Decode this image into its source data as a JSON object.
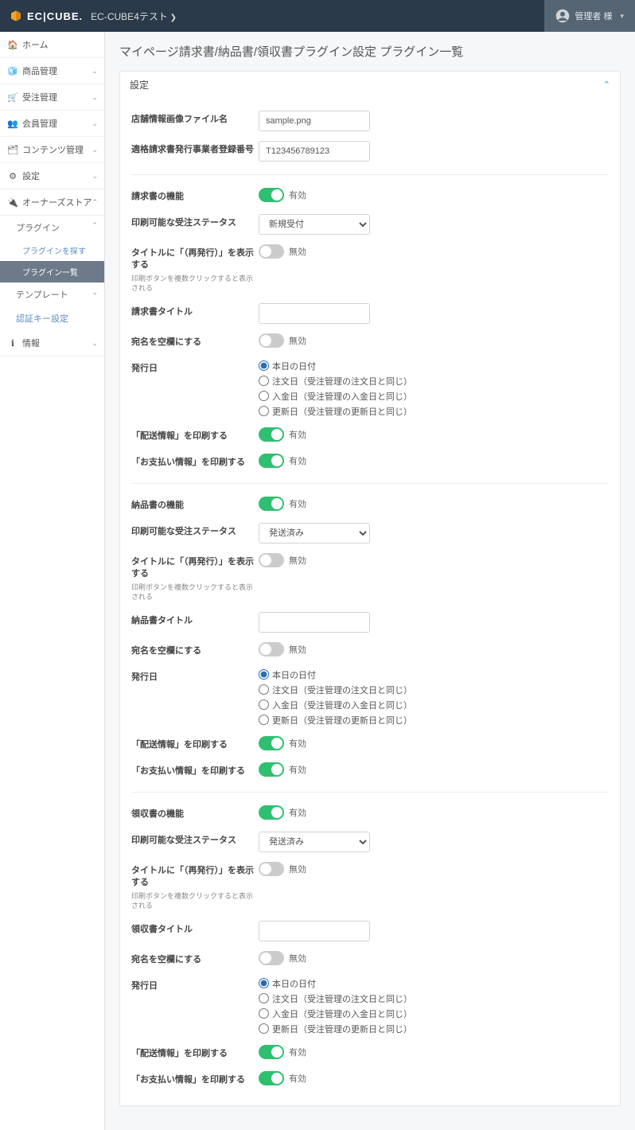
{
  "header": {
    "logo_text": "EC|CUBE.",
    "shop_name": "EC-CUBE4テスト",
    "user_name": "管理者 様"
  },
  "sidebar": {
    "items": [
      {
        "icon": "🏠",
        "label": "ホーム"
      },
      {
        "icon": "🧊",
        "label": "商品管理",
        "chev": "⌄"
      },
      {
        "icon": "🛒",
        "label": "受注管理",
        "chev": "⌄"
      },
      {
        "icon": "👥",
        "label": "会員管理",
        "chev": "⌄"
      },
      {
        "icon": "🗂",
        "label": "コンテンツ管理",
        "chev": "⌄"
      },
      {
        "icon": "⚙",
        "label": "設定",
        "chev": "⌄"
      },
      {
        "icon": "🔌",
        "label": "オーナーズストア",
        "chev": "⌃"
      }
    ],
    "sub_plugin": {
      "label": "プラグイン",
      "chev": "⌃"
    },
    "sub2_search": "プラグインを探す",
    "sub2_list": "プラグイン一覧",
    "sub_template": {
      "label": "テンプレート",
      "chev": "⌄"
    },
    "sub_auth": "認証キー設定",
    "info": {
      "icon": "ℹ",
      "label": "情報",
      "chev": "⌄"
    }
  },
  "page": {
    "title": "マイページ請求書/納品書/領収書プラグイン設定 プラグイン一覧"
  },
  "card": {
    "header": "設定"
  },
  "labels": {
    "on": "有効",
    "off": "無効"
  },
  "form": {
    "shop_image_label": "店舗情報画像ファイル名",
    "shop_image_value": "sample.png",
    "invoice_reg_label": "適格請求書発行事業者登録番号",
    "invoice_reg_value": "T123456789123",
    "invoice_section": "請求書の機能",
    "invoice_printable_status_label": "印刷可能な受注ステータス",
    "invoice_printable_status_value": "新規受付",
    "invoice_reissue_label": "タイトルに「（再発行）」を表示する",
    "invoice_reissue_sub": "印刷ボタンを複数クリックすると表示される",
    "invoice_title_label": "請求書タイトル",
    "invoice_title_value": "",
    "invoice_blank_addressee_label": "宛名を空欄にする",
    "invoice_date_label": "発行日",
    "invoice_shipping_label": "「配送情報」を印刷する",
    "invoice_payment_label": "「お支払い情報」を印刷する",
    "delivery_section": "納品書の機能",
    "delivery_printable_status_label": "印刷可能な受注ステータス",
    "delivery_printable_status_value": "発送済み",
    "delivery_reissue_label": "タイトルに「（再発行）」を表示する",
    "delivery_reissue_sub": "印刷ボタンを複数クリックすると表示される",
    "delivery_title_label": "納品書タイトル",
    "delivery_title_value": "",
    "delivery_blank_addressee_label": "宛名を空欄にする",
    "delivery_date_label": "発行日",
    "delivery_shipping_label": "「配送情報」を印刷する",
    "delivery_payment_label": "「お支払い情報」を印刷する",
    "receipt_section": "領収書の機能",
    "receipt_printable_status_label": "印刷可能な受注ステータス",
    "receipt_printable_status_value": "発送済み",
    "receipt_reissue_label": "タイトルに「（再発行）」を表示する",
    "receipt_reissue_sub": "印刷ボタンを複数クリックすると表示される",
    "receipt_title_label": "領収書タイトル",
    "receipt_title_value": "",
    "receipt_blank_addressee_label": "宛名を空欄にする",
    "receipt_date_label": "発行日",
    "receipt_shipping_label": "「配送情報」を印刷する",
    "receipt_payment_label": "「お支払い情報」を印刷する"
  },
  "date_options": {
    "today": "本日の日付",
    "order": "注文日（受注管理の注文日と同じ）",
    "payment": "入金日（受注管理の入金日と同じ）",
    "update": "更新日（受注管理の更新日と同じ）"
  }
}
